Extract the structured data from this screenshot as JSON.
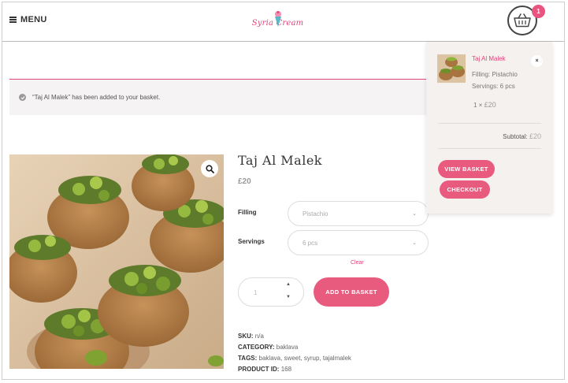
{
  "header": {
    "menu_label": "MENU",
    "logo_text": "Syria Cream",
    "basket_count": "1"
  },
  "notice": {
    "text": "“Taj Al Malek” has been added to your basket."
  },
  "product": {
    "title": "Taj Al Malek",
    "price": "£20",
    "filling_label": "Filling",
    "filling_value": "Pistachio",
    "servings_label": "Servings",
    "servings_value": "6 pcs",
    "clear_label": "Clear",
    "quantity": "1",
    "add_to_basket_label": "ADD TO BASKET",
    "meta": {
      "sku_label": "SKU:",
      "sku": "n/a",
      "category_label": "CATEGORY:",
      "category": "baklava",
      "tags_label": "TAGS:",
      "tags": "baklava, sweet, syrup, tajalmalek",
      "product_id_label": "PRODUCT ID:",
      "product_id": "168"
    }
  },
  "mini_cart": {
    "item_name": "Taj Al Malek",
    "filling_line": "Filling: Pistachio",
    "servings_line": "Servings: 6 pcs",
    "qty_prefix": "1 ×",
    "qty_price": "£20",
    "remove_symbol": "×",
    "subtotal_label": "Subtotal:",
    "subtotal_value": "£20",
    "view_basket_label": "VIEW BASKET",
    "checkout_label": "CHECKOUT"
  },
  "colors": {
    "accent": "#e85a7e",
    "link": "#e0457b",
    "notice_bg": "#f5f3f3",
    "mini_cart_bg": "#f5f1ee"
  },
  "icons": {
    "menu": "hamburger-icon",
    "basket": "basket-icon",
    "zoom": "magnifier-icon",
    "notice": "check-circle-icon",
    "select": "chevron-down-icon",
    "qty_up": "chevron-up-icon",
    "qty_down": "chevron-down-icon",
    "remove": "close-icon"
  }
}
